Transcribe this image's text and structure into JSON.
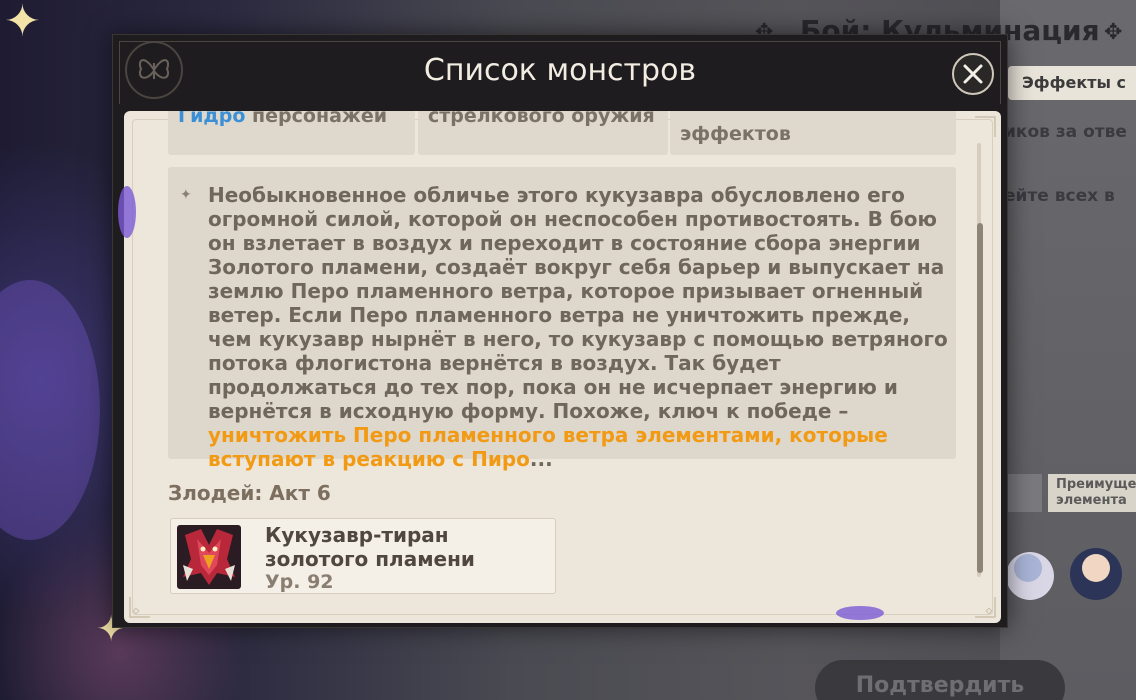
{
  "background": {
    "title": "Бой: Кульминация",
    "tab_label": "Эффекты с",
    "line1": "иков за отве",
    "line2": "ейте всех в",
    "advantage": "Преимуще\nэлемента",
    "confirm_label": "Подтвердить"
  },
  "modal": {
    "title": "Список монстров",
    "tabs": [
      {
        "label_highlight": "Гидро",
        "label_rest": " персонажей"
      },
      {
        "label": "стрелкового оружия"
      },
      {
        "label": "эффектов"
      }
    ],
    "description": {
      "text": "Необыкновенное обличье этого кукузавра обусловлено его огромной силой, которой он неспособен противостоять. В бою он взлетает в воздух и переходит в состояние сбора энергии Золотого пламени, создаёт вокруг себя барьер и выпускает на землю Перо пламенного ветра, которое призывает огненный ветер. Если Перо пламенного ветра не уничтожить прежде, чем кукузавр нырнёт в него, то кукузавр с помощью ветряного потока флогистона вернётся в воздух. Так будет продолжаться до тех пор, пока он не исчерпает энергию и вернётся в исходную форму. Похоже, ключ к победе – ",
      "highlight": "уничтожить Перо пламенного ветра элементами, которые вступают в реакцию с Пиро",
      "ellipsis": "..."
    },
    "villains_label": "Злодей: Акт 6",
    "monster": {
      "name": "Кукузавр-тиран золотого пламени",
      "level": "Ур. 92"
    }
  },
  "colors": {
    "accent_orange": "#f29a13",
    "hydro_blue": "#3b8fd6",
    "panel_bg": "#ece6db",
    "frame_dark": "#1e1c1f"
  },
  "icons": {
    "close": "close-icon",
    "emblem": "butterfly-emblem-icon",
    "bullet": "diamond-bullet-icon"
  }
}
